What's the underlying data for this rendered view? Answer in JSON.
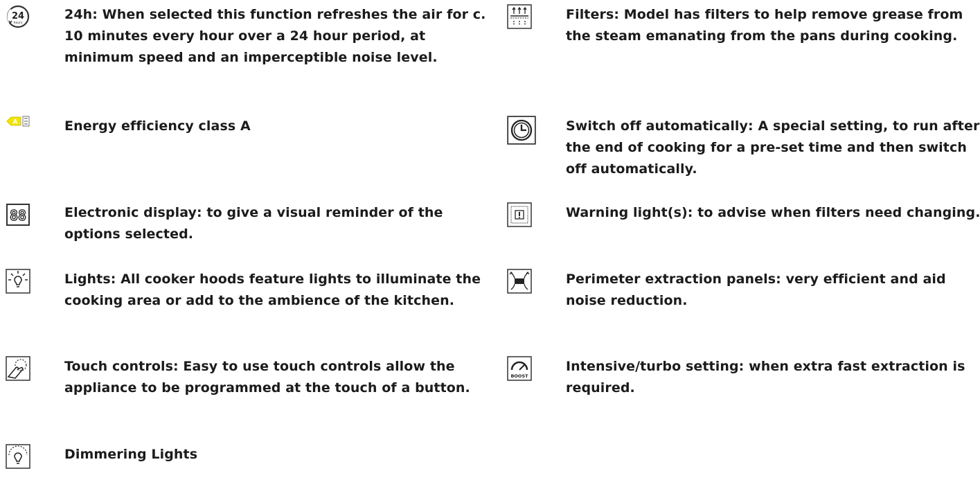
{
  "features_left": [
    {
      "icon": "24-hours-icon",
      "text": "24h: When selected this function refreshes the air for c. 10 minutes every hour over a 24 hour period, at minimum speed and an imperceptible noise level."
    },
    {
      "icon": "energy-class-a-icon",
      "text": "Energy efficiency class A"
    },
    {
      "icon": "electronic-display-icon",
      "text": "Electronic display: to give a visual reminder of the options selected."
    },
    {
      "icon": "lights-icon",
      "text": "Lights: All cooker hoods feature lights to illuminate the cooking area or add to the ambience of the kitchen."
    },
    {
      "icon": "touch-controls-icon",
      "text": "Touch controls: Easy to use touch controls allow the appliance to be programmed at the touch of a button."
    },
    {
      "icon": "dimmering-lights-icon",
      "text": "Dimmering Lights"
    }
  ],
  "features_right": [
    {
      "icon": "filters-icon",
      "text": "Filters: Model has filters to help remove grease from the steam emanating from the pans during cooking."
    },
    {
      "icon": "auto-switch-off-icon",
      "text": "Switch off automatically: A special setting, to run after the end of cooking for a pre-set time and then switch off automatically."
    },
    {
      "icon": "warning-light-icon",
      "text": "Warning light(s): to advise when filters need changing."
    },
    {
      "icon": "perimeter-extraction-icon",
      "text": "Perimeter extraction panels: very efficient and aid noise reduction."
    },
    {
      "icon": "boost-icon",
      "text": "Intensive/turbo setting: when extra fast extraction is required."
    }
  ],
  "icon_labels": {
    "hours_number": "24",
    "hours_word": "hours",
    "energy_class": "A",
    "display_digits": "88",
    "boost": "BOOST"
  },
  "colors": {
    "text": "#1b1b1b",
    "icon_stroke": "#333333",
    "energy_green": "#f2e500"
  }
}
